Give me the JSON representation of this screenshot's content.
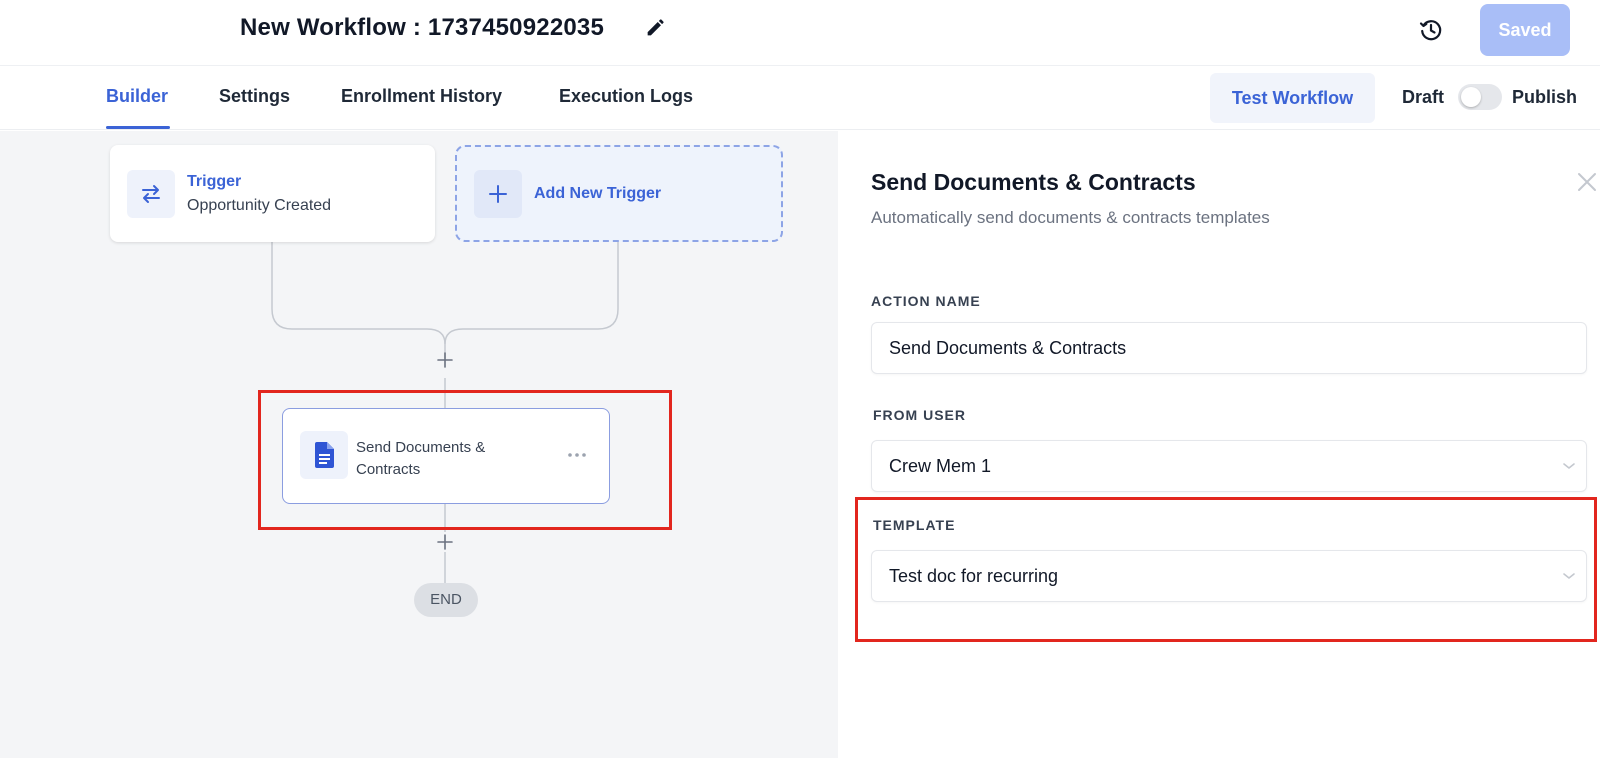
{
  "header": {
    "workflow_title": "New Workflow : 1737450922035",
    "saved_label": "Saved"
  },
  "tabs": [
    {
      "label": "Builder",
      "active": true
    },
    {
      "label": "Settings",
      "active": false
    },
    {
      "label": "Enrollment History",
      "active": false
    },
    {
      "label": "Execution Logs",
      "active": false
    }
  ],
  "toolbar": {
    "test_workflow_label": "Test Workflow",
    "draft_label": "Draft",
    "publish_label": "Publish",
    "publish_toggle_on": false
  },
  "canvas": {
    "trigger": {
      "title": "Trigger",
      "subtitle": "Opportunity Created"
    },
    "add_trigger_label": "Add New Trigger",
    "action": {
      "label": "Send Documents & Contracts"
    },
    "end_label": "END"
  },
  "panel": {
    "title": "Send Documents & Contracts",
    "subtitle": "Automatically send documents & contracts templates",
    "action_name_label": "ACTION NAME",
    "action_name_value": "Send Documents & Contracts",
    "from_user_label": "FROM USER",
    "from_user_value": "Crew Mem 1",
    "template_label": "TEMPLATE",
    "template_value": "Test doc for recurring"
  },
  "colors": {
    "accent": "#3b63d6",
    "saved_button": "#a9bef7",
    "highlight": "#e2261e",
    "canvas_bg": "#f4f5f7"
  },
  "icons": [
    "pencil-icon",
    "history-icon",
    "swap-arrows-icon",
    "plus-icon",
    "document-icon",
    "more-horizontal-icon",
    "close-icon",
    "chevron-down-icon"
  ]
}
